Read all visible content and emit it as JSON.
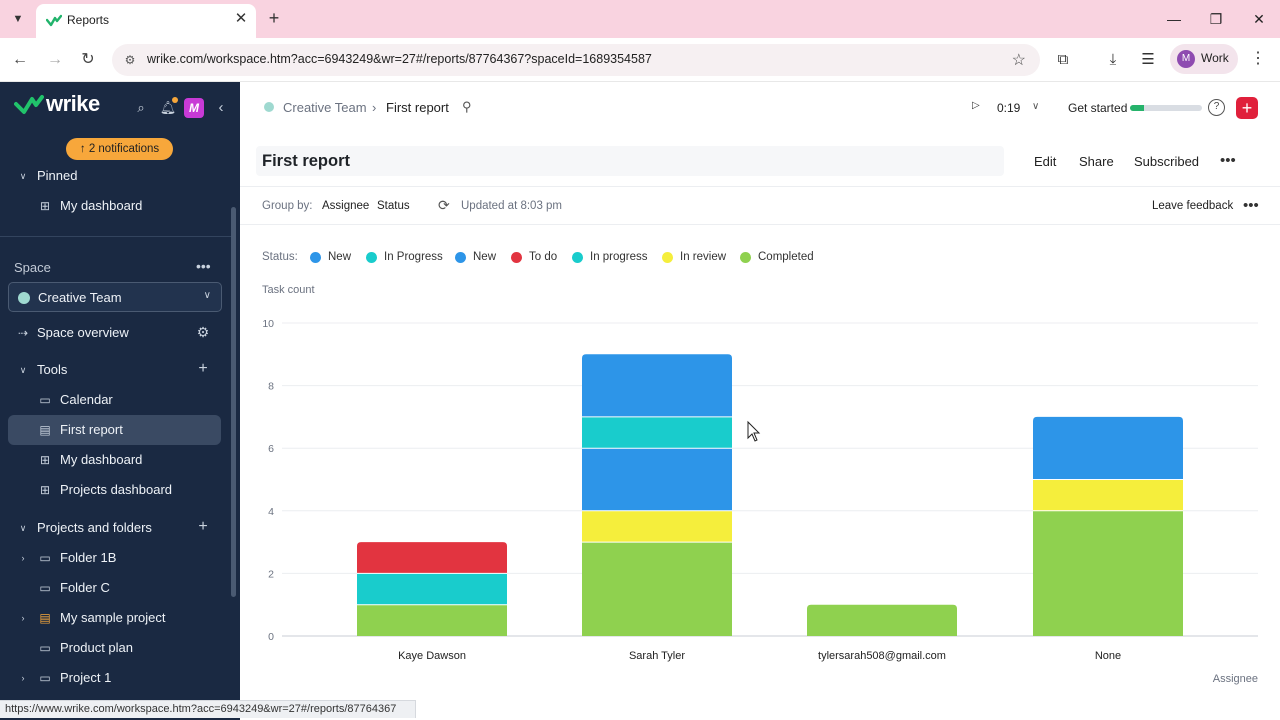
{
  "browser": {
    "tab_title": "Reports",
    "url": "wrike.com/workspace.htm?acc=6943249&wr=27#/reports/87764367?spaceId=1689354587",
    "profile_initial": "M",
    "profile_label": "Work",
    "status_url": "https://www.wrike.com/workspace.htm?acc=6943249&wr=27#/reports/87764367"
  },
  "sidebar": {
    "logo": "wrike",
    "badge_letter": "M",
    "notifications": "2 notifications",
    "pinned_label": "Pinned",
    "pinned_items": [
      {
        "label": "My dashboard"
      }
    ],
    "space_label": "Space",
    "space_selected": "Creative Team",
    "space_overview": "Space overview",
    "tools_label": "Tools",
    "tools_items": [
      {
        "label": "Calendar"
      },
      {
        "label": "First report"
      },
      {
        "label": "My dashboard"
      },
      {
        "label": "Projects dashboard"
      }
    ],
    "projects_label": "Projects and folders",
    "projects_items": [
      {
        "label": "Folder 1B"
      },
      {
        "label": "Folder C"
      },
      {
        "label": "My sample project"
      },
      {
        "label": "Product plan"
      },
      {
        "label": "Project 1"
      }
    ]
  },
  "header": {
    "breadcrumb_space": "Creative Team",
    "breadcrumb_separator": "›",
    "breadcrumb_current": "First report",
    "timer": "0:19",
    "get_started": "Get started",
    "get_started_progress": 0.2
  },
  "report": {
    "title": "First report",
    "actions": {
      "edit": "Edit",
      "share": "Share",
      "subscribed": "Subscribed"
    },
    "group_by_label": "Group by:",
    "group_by_1": "Assignee",
    "group_by_2": "Status",
    "updated": "Updated at 8:03 pm",
    "leave_feedback": "Leave feedback",
    "status_label": "Status:"
  },
  "chart_data": {
    "type": "bar",
    "stacked": true,
    "ylabel": "Task count",
    "xlabel": "Assignee",
    "ylim": [
      0,
      10
    ],
    "yticks": [
      0,
      2,
      4,
      6,
      8,
      10
    ],
    "grid": true,
    "legend_position": "top",
    "categories": [
      "Kaye Dawson",
      "Sarah Tyler",
      "tylersarah508@gmail.com",
      "None"
    ],
    "series": [
      {
        "name": "Completed",
        "color": "#8fd14f",
        "values": [
          1,
          3,
          1,
          4
        ]
      },
      {
        "name": "In review",
        "color": "#f5ee3c",
        "values": [
          0,
          1,
          0,
          1
        ]
      },
      {
        "name": "New",
        "color": "#2d95e8",
        "values": [
          0,
          2,
          0,
          0
        ]
      },
      {
        "name": "In progress",
        "color": "#19cccc",
        "values": [
          1,
          1,
          0,
          0
        ]
      },
      {
        "name": "To do",
        "color": "#e23440",
        "values": [
          1,
          0,
          0,
          0
        ]
      },
      {
        "name": "New",
        "color": "#2d95e8",
        "values": [
          0,
          2,
          0,
          2
        ]
      }
    ],
    "legend": [
      {
        "name": "New",
        "color": "#2d95e8"
      },
      {
        "name": "In Progress",
        "color": "#19cccc"
      },
      {
        "name": "New",
        "color": "#2d95e8"
      },
      {
        "name": "To do",
        "color": "#e23440"
      },
      {
        "name": "In progress",
        "color": "#19cccc"
      },
      {
        "name": "In review",
        "color": "#f5ee3c"
      },
      {
        "name": "Completed",
        "color": "#8fd14f"
      }
    ]
  }
}
